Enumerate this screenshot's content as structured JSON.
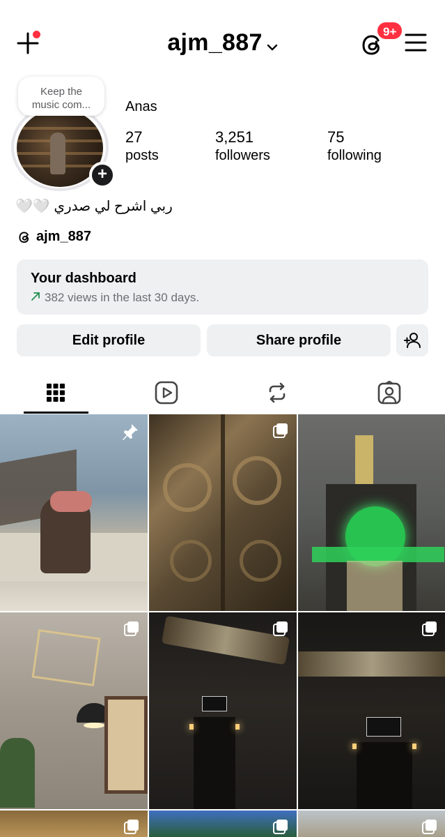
{
  "header": {
    "username": "ajm_887",
    "notification_badge": "9+",
    "icons": [
      "plus-icon",
      "chevron-down-icon",
      "threads-icon",
      "hamburger-menu-icon"
    ]
  },
  "profile": {
    "note": "Keep the music com...",
    "display_name": "Anas",
    "stats": [
      {
        "value": "27",
        "label": "posts"
      },
      {
        "value": "3,251",
        "label": "followers"
      },
      {
        "value": "75",
        "label": "following"
      }
    ],
    "bio": "🤍🤍 ربي اشرح لي صدري",
    "threads_handle": "ajm_887"
  },
  "dashboard": {
    "title": "Your dashboard",
    "subtitle": "382 views in the last 30 days."
  },
  "actions": {
    "edit_label": "Edit profile",
    "share_label": "Share profile"
  },
  "tabs": [
    "grid-icon",
    "reels-icon",
    "reposts-icon",
    "tagged-icon"
  ],
  "grid": {
    "posts": [
      {
        "name": "post-man-praying-boat",
        "badge": "pin-icon"
      },
      {
        "name": "post-kaaba-door",
        "badge": "carousel-icon"
      },
      {
        "name": "post-clock-tower",
        "badge": ""
      },
      {
        "name": "post-caffeine-cafe",
        "badge": "carousel-icon"
      },
      {
        "name": "post-valley-storefront-1",
        "badge": "carousel-icon"
      },
      {
        "name": "post-valley-storefront-2",
        "badge": "carousel-icon"
      },
      {
        "name": "post-bottom-1",
        "badge": "carousel-icon"
      },
      {
        "name": "post-bottom-2",
        "badge": "carousel-icon"
      },
      {
        "name": "post-bottom-3",
        "badge": "carousel-icon"
      }
    ]
  },
  "colors": {
    "accent_red": "#ff3040",
    "button_bg": "#eff0f2",
    "trend_green": "#1f8f4f"
  }
}
